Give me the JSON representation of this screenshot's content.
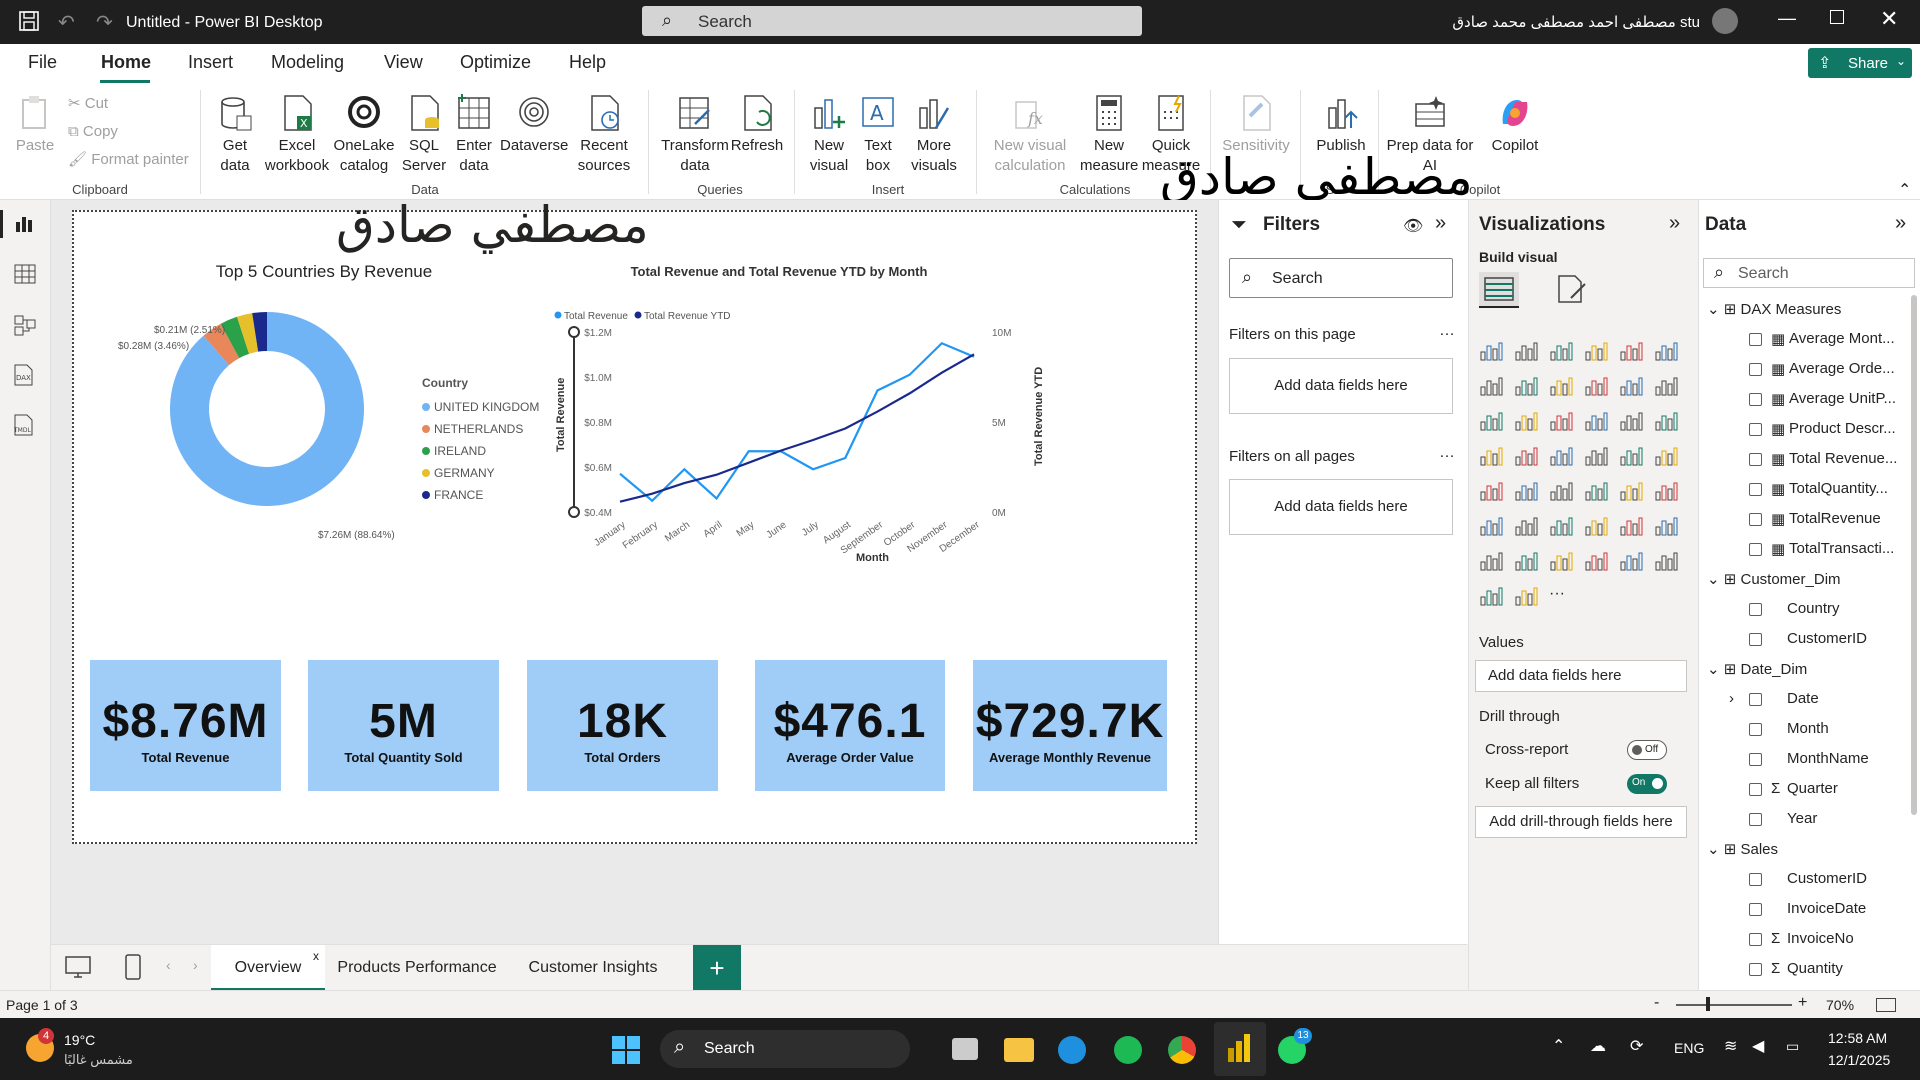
{
  "window": {
    "title": "Untitled - Power BI Desktop",
    "search": "Search",
    "user": "stu مصطفى احمد مصطفى محمد صادق"
  },
  "menu": {
    "tabs": [
      "File",
      "Home",
      "Insert",
      "Modeling",
      "View",
      "Optimize",
      "Help"
    ],
    "share": "Share"
  },
  "ribbon": {
    "clipboard": {
      "paste": "Paste",
      "cut": "Cut",
      "copy": "Copy",
      "format_painter": "Format painter",
      "group": "Clipboard"
    },
    "data": {
      "get_data": "Get data",
      "excel": "Excel workbook",
      "onelake": "OneLake catalog",
      "sql": "SQL Server",
      "enter": "Enter data",
      "dataverse": "Dataverse",
      "recent": "Recent sources",
      "group": "Data"
    },
    "queries": {
      "transform": "Transform data",
      "refresh": "Refresh",
      "group": "Queries"
    },
    "insert": {
      "new_visual": "New visual",
      "text_box": "Text box",
      "more_visuals": "More visuals",
      "group": "Insert"
    },
    "calculations": {
      "new_visual_calc": "New visual calculation",
      "new_measure": "New measure",
      "quick_measure": "Quick measure",
      "group": "Calculations"
    },
    "sensitivity": {
      "label": "Sensitivity",
      "group": "S"
    },
    "share": {
      "publish": "Publish"
    },
    "copilot": {
      "prep": "Prep data for AI",
      "copilot": "Copilot",
      "group": "Copilot"
    }
  },
  "watermark": {
    "name": "مصطفي صادق"
  },
  "report": {
    "donut": {
      "title": "Top 5 Countries By Revenue",
      "legend_title": "Country",
      "labels": [
        "$0.21M (2.51%)",
        "$0.28M (3.46%)",
        "$7.26M (88.64%)"
      ]
    },
    "line": {
      "title": "Total Revenue and Total Revenue YTD by Month",
      "xlabel": "Month",
      "ylabel": "Total Revenue",
      "y2label": "Total Revenue YTD",
      "legend": [
        "Total Revenue",
        "Total Revenue YTD"
      ],
      "yticks": [
        "$1.2M",
        "$1.0M",
        "$0.8M",
        "$0.6M",
        "$0.4M"
      ],
      "y2ticks": [
        "10M",
        "5M",
        "0M"
      ]
    },
    "kpis": [
      {
        "value": "$8.76M",
        "label": "Total Revenue"
      },
      {
        "value": "5M",
        "label": "Total Quantity Sold"
      },
      {
        "value": "18K",
        "label": "Total Orders"
      },
      {
        "value": "$476.1",
        "label": "Average Order Value"
      },
      {
        "value": "$729.7K",
        "label": "Average Monthly Revenue"
      }
    ]
  },
  "chart_data": [
    {
      "type": "pie",
      "title": "Top 5 Countries By Revenue",
      "legend_title": "Country",
      "categories": [
        "UNITED KINGDOM",
        "NETHERLANDS",
        "IRELAND",
        "GERMANY",
        "FRANCE"
      ],
      "values": [
        7.26,
        0.28,
        0.24,
        0.21,
        0.2
      ],
      "colors": [
        "#71b4f5",
        "#e9875a",
        "#2ba14a",
        "#e6c02b",
        "#1a2a8c"
      ],
      "unit": "$M"
    },
    {
      "type": "line",
      "title": "Total Revenue and Total Revenue YTD by Month",
      "xlabel": "Month",
      "ylabel": "Total Revenue",
      "y2label": "Total Revenue YTD",
      "categories": [
        "January",
        "February",
        "March",
        "April",
        "May",
        "June",
        "July",
        "August",
        "September",
        "October",
        "November",
        "December"
      ],
      "ylim": [
        0.4,
        1.2
      ],
      "y2lim": [
        0,
        10
      ],
      "series": [
        {
          "name": "Total Revenue",
          "axis": "left",
          "color": "#2196f3",
          "values": [
            0.57,
            0.45,
            0.59,
            0.46,
            0.67,
            0.67,
            0.59,
            0.64,
            0.94,
            1.01,
            1.15,
            1.09
          ]
        },
        {
          "name": "Total Revenue YTD",
          "axis": "right",
          "color": "#1a2a8c",
          "values": [
            0.57,
            1.02,
            1.61,
            2.07,
            2.74,
            3.41,
            4.0,
            4.64,
            5.58,
            6.59,
            7.74,
            8.76
          ]
        }
      ]
    }
  ],
  "filters": {
    "title": "Filters",
    "search": "Search",
    "on_page": "Filters on this page",
    "on_all": "Filters on all pages",
    "add": "Add data fields here"
  },
  "viz": {
    "title": "Visualizations",
    "build": "Build visual",
    "values": "Values",
    "add": "Add data fields here",
    "drill": "Drill through",
    "cross": "Cross-report",
    "cross_state": "Off",
    "keep": "Keep all filters",
    "keep_state": "On",
    "add_drill": "Add drill-through fields here"
  },
  "data_pane": {
    "title": "Data",
    "search": "Search",
    "tables": [
      {
        "name": "DAX Measures",
        "fields": [
          "Average Mont...",
          "Average Orde...",
          "Average UnitP...",
          "Product Descr...",
          "Total Revenue...",
          "TotalQuantity...",
          "TotalRevenue",
          "TotalTransacti..."
        ]
      },
      {
        "name": "Customer_Dim",
        "fields": [
          "Country",
          "CustomerID"
        ]
      },
      {
        "name": "Date_Dim",
        "fields": [
          "Date",
          "Month",
          "MonthName",
          "Quarter",
          "Year"
        ]
      },
      {
        "name": "Sales",
        "fields": [
          "CustomerID",
          "InvoiceDate",
          "InvoiceNo",
          "Quantity"
        ]
      }
    ]
  },
  "pages": {
    "tabs": [
      "Overview",
      "Products Performance",
      "Customer Insights"
    ],
    "close": "x",
    "add": "+"
  },
  "status": {
    "page": "Page 1 of 3",
    "zoom": "70%",
    "minus": "-",
    "plus": "+"
  },
  "taskbar": {
    "temp": "19°C",
    "weather": "مشمس غالبًا",
    "badge": "4",
    "search": "Search",
    "lang": "ENG",
    "time": "12:58 AM",
    "date": "12/1/2025",
    "wa_badge": "13"
  }
}
